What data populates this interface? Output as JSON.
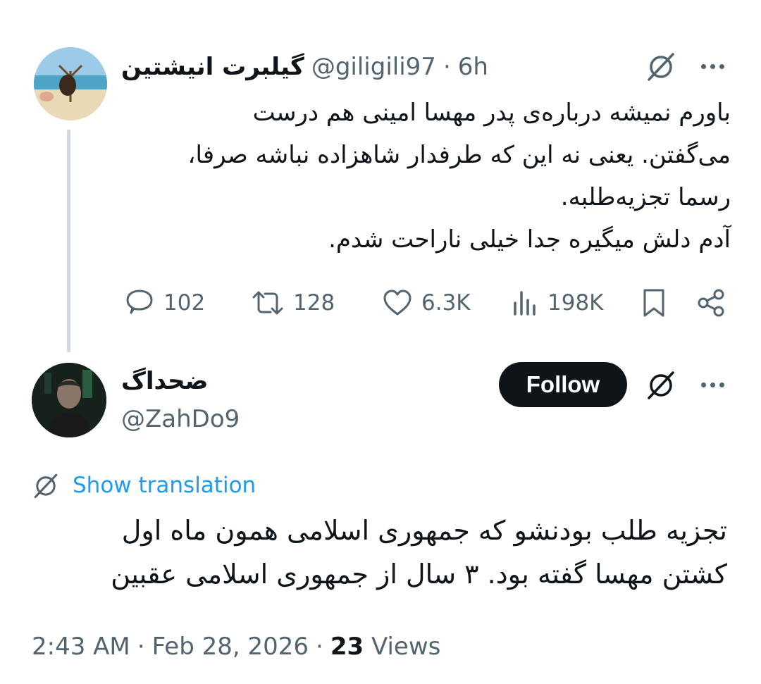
{
  "parent_tweet": {
    "display_name": "گیلبرت انیشتین",
    "handle": "@giligili97",
    "separator": "·",
    "time": "6h",
    "text_lines": [
      "باورم نمیشه درباره‌ی پدر مهسا امینی هم درست",
      "می‌گفتن. یعنی نه این که طرفدار شاهزاده نباشه صرفا،",
      "رسما تجزیه‌طلبه.",
      "آدم دلش میگیره جدا خیلی ناراحت شدم."
    ],
    "stats": {
      "replies": "102",
      "reposts": "128",
      "likes": "6.3K",
      "views": "198K"
    }
  },
  "reply_tweet": {
    "display_name": "ضحداگ",
    "handle": "@ZahDo9",
    "follow_label": "Follow",
    "show_translation_label": "Show translation",
    "text_lines": [
      "تجزیه طلب بودنشو که جمهوری اسلامی همون ماه اول",
      "کشتن مهسا گفته بود. ۳ سال از جمهوری اسلامی عقبین"
    ],
    "time": "2:43 AM",
    "separator": "·",
    "date": "Feb 28, 2026",
    "views_count": "23",
    "views_label": "Views"
  },
  "icons": {
    "grok": "grok-icon",
    "more": "more-dots-icon",
    "reply": "reply-bubble-icon",
    "repost": "repost-icon",
    "like": "heart-icon",
    "views": "views-bars-icon",
    "bookmark": "bookmark-icon",
    "share": "share-icon",
    "translate": "grok-translate-icon"
  },
  "colors": {
    "text": "#0f1419",
    "muted": "#536471",
    "accent": "#1d9bf0",
    "thread_line": "#cfd9de",
    "follow_bg": "#0f1419"
  }
}
